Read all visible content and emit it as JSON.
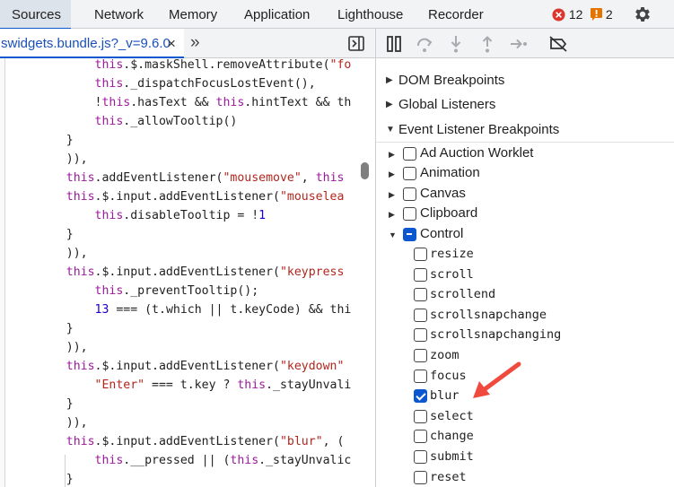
{
  "top_tabs": [
    "Sources",
    "Network",
    "Memory",
    "Application",
    "Lighthouse",
    "Recorder"
  ],
  "badges": {
    "errors": "12",
    "warnings": "2"
  },
  "file_tab": {
    "name": "swidgets.bundle.js?_v=9.6.0",
    "close": "×",
    "more": "»"
  },
  "code_lines": [
    "        this.$.maskShell.removeAttribute(\"fo",
    "        this._dispatchFocusLostEvent(),",
    "        !this.hasText && this.hintText && th",
    "        this._allowTooltip()",
    "    }",
    "    )),",
    "    this.addEventListener(\"mousemove\", this",
    "    this.$.input.addEventListener(\"mouselea",
    "        this.disableTooltip = !1",
    "    }",
    "    )),",
    "    this.$.input.addEventListener(\"keypress",
    "        this._preventTooltip();",
    "        13 === (t.which || t.keyCode) && thi",
    "    }",
    "    )),",
    "    this.$.input.addEventListener(\"keydown\"",
    "        \"Enter\" === t.key ? this._stayUnvali",
    "    }",
    "    )),",
    "    this.$.input.addEventListener(\"blur\", (",
    "        this.__pressed || (this._stayUnvalic",
    "    }"
  ],
  "sections": [
    {
      "label": "DOM Breakpoints",
      "expanded": false
    },
    {
      "label": "Global Listeners",
      "expanded": false
    },
    {
      "label": "Event Listener Breakpoints",
      "expanded": true
    }
  ],
  "categories": [
    {
      "label": "Ad Auction Worklet",
      "expanded": false,
      "state": "unchecked"
    },
    {
      "label": "Animation",
      "expanded": false,
      "state": "unchecked"
    },
    {
      "label": "Canvas",
      "expanded": false,
      "state": "unchecked"
    },
    {
      "label": "Clipboard",
      "expanded": false,
      "state": "unchecked"
    },
    {
      "label": "Control",
      "expanded": true,
      "state": "mixed"
    }
  ],
  "control_events": [
    {
      "label": "resize",
      "checked": false
    },
    {
      "label": "scroll",
      "checked": false
    },
    {
      "label": "scrollend",
      "checked": false
    },
    {
      "label": "scrollsnapchange",
      "checked": false
    },
    {
      "label": "scrollsnapchanging",
      "checked": false
    },
    {
      "label": "zoom",
      "checked": false
    },
    {
      "label": "focus",
      "checked": false
    },
    {
      "label": "blur",
      "checked": true
    },
    {
      "label": "select",
      "checked": false
    },
    {
      "label": "change",
      "checked": false
    },
    {
      "label": "submit",
      "checked": false
    },
    {
      "label": "reset",
      "checked": false
    }
  ],
  "colors": {
    "accent": "#0b57d0",
    "error": "#dc362e",
    "warning": "#e37400",
    "annotation_arrow": "#f04a3e"
  }
}
